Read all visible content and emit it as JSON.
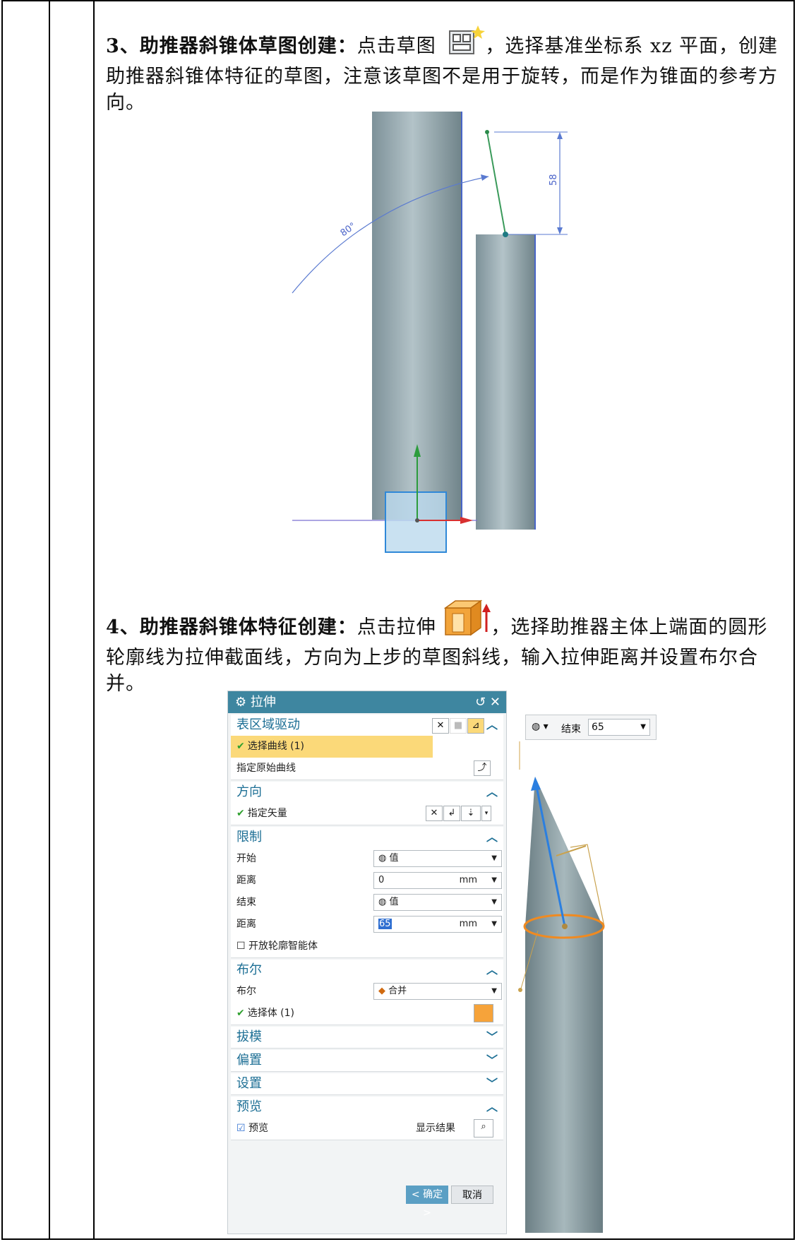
{
  "step3": {
    "title": "3、助推器斜锥体草图创建：",
    "text_a": "点击草图",
    "text_b": "，选择基准坐标系 xz 平面，创建助推器斜锥体特征的草图，注意该草图不是用于旋转，而是作为锥面的参考方向。",
    "dim_length": "58",
    "dim_angle": "80°"
  },
  "step4": {
    "title": "4、助推器斜锥体特征创建：",
    "text_a": "点击拉伸",
    "text_b": "，选择助推器主体上端面的圆形轮廓线为拉伸截面线，方向为上步的草图斜线，输入拉伸距离并设置布尔合并。"
  },
  "dialog": {
    "title": "拉伸",
    "title_controls": "↺ ✕",
    "sections": {
      "region": {
        "label": "表区域驱动",
        "select_curve": "选择曲线 (1)",
        "original_curve": "指定原始曲线"
      },
      "direction": {
        "label": "方向",
        "vector": "指定矢量"
      },
      "limits": {
        "label": "限制",
        "start_label": "开始",
        "start_value": "值",
        "dist1_label": "距离",
        "dist1_value": "0",
        "dist1_unit": "mm",
        "end_label": "结束",
        "end_value": "值",
        "dist2_label": "距离",
        "dist2_value": "65",
        "dist2_unit": "mm",
        "open_profile": "开放轮廓智能体"
      },
      "boolean": {
        "label": "布尔",
        "bool_label": "布尔",
        "bool_value": "合并",
        "select_body": "选择体 (1)"
      },
      "draft": {
        "label": "拔模"
      },
      "offset": {
        "label": "偏置"
      },
      "settings": {
        "label": "设置"
      },
      "preview": {
        "label": "预览",
        "preview_check": "预览",
        "show_result": "显示结果"
      }
    },
    "ok": "< 确定 >",
    "cancel": "取消"
  },
  "float_toolbar": {
    "end_label": "结束",
    "end_value": "65"
  }
}
